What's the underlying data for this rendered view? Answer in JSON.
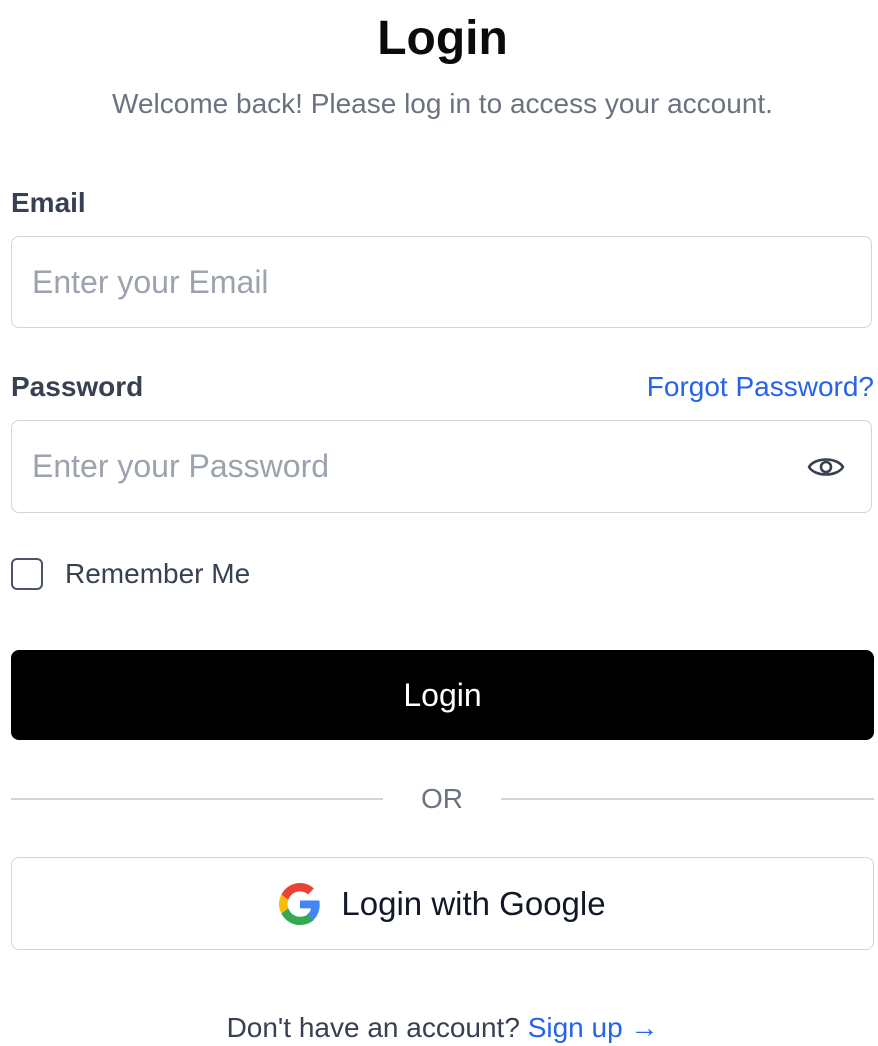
{
  "header": {
    "title": "Login",
    "subtitle": "Welcome back! Please log in to access your account."
  },
  "email": {
    "label": "Email",
    "value": "",
    "placeholder": "Enter your Email"
  },
  "password": {
    "label": "Password",
    "value": "",
    "placeholder": "Enter your Password",
    "toggle_icon": "eye-icon"
  },
  "forgot_password": {
    "label": "Forgot Password?"
  },
  "remember_me": {
    "label": "Remember Me",
    "checked": false
  },
  "login_button": {
    "label": "Login"
  },
  "divider": {
    "text": "OR"
  },
  "google_button": {
    "label": "Login with Google",
    "icon": "google-icon"
  },
  "signup": {
    "prompt": "Don't have an account?",
    "link_label": "Sign up →"
  },
  "colors": {
    "link": "#2563eb",
    "primary_button": "#000000",
    "border": "#d1d5db",
    "muted_text": "#6b7280"
  }
}
